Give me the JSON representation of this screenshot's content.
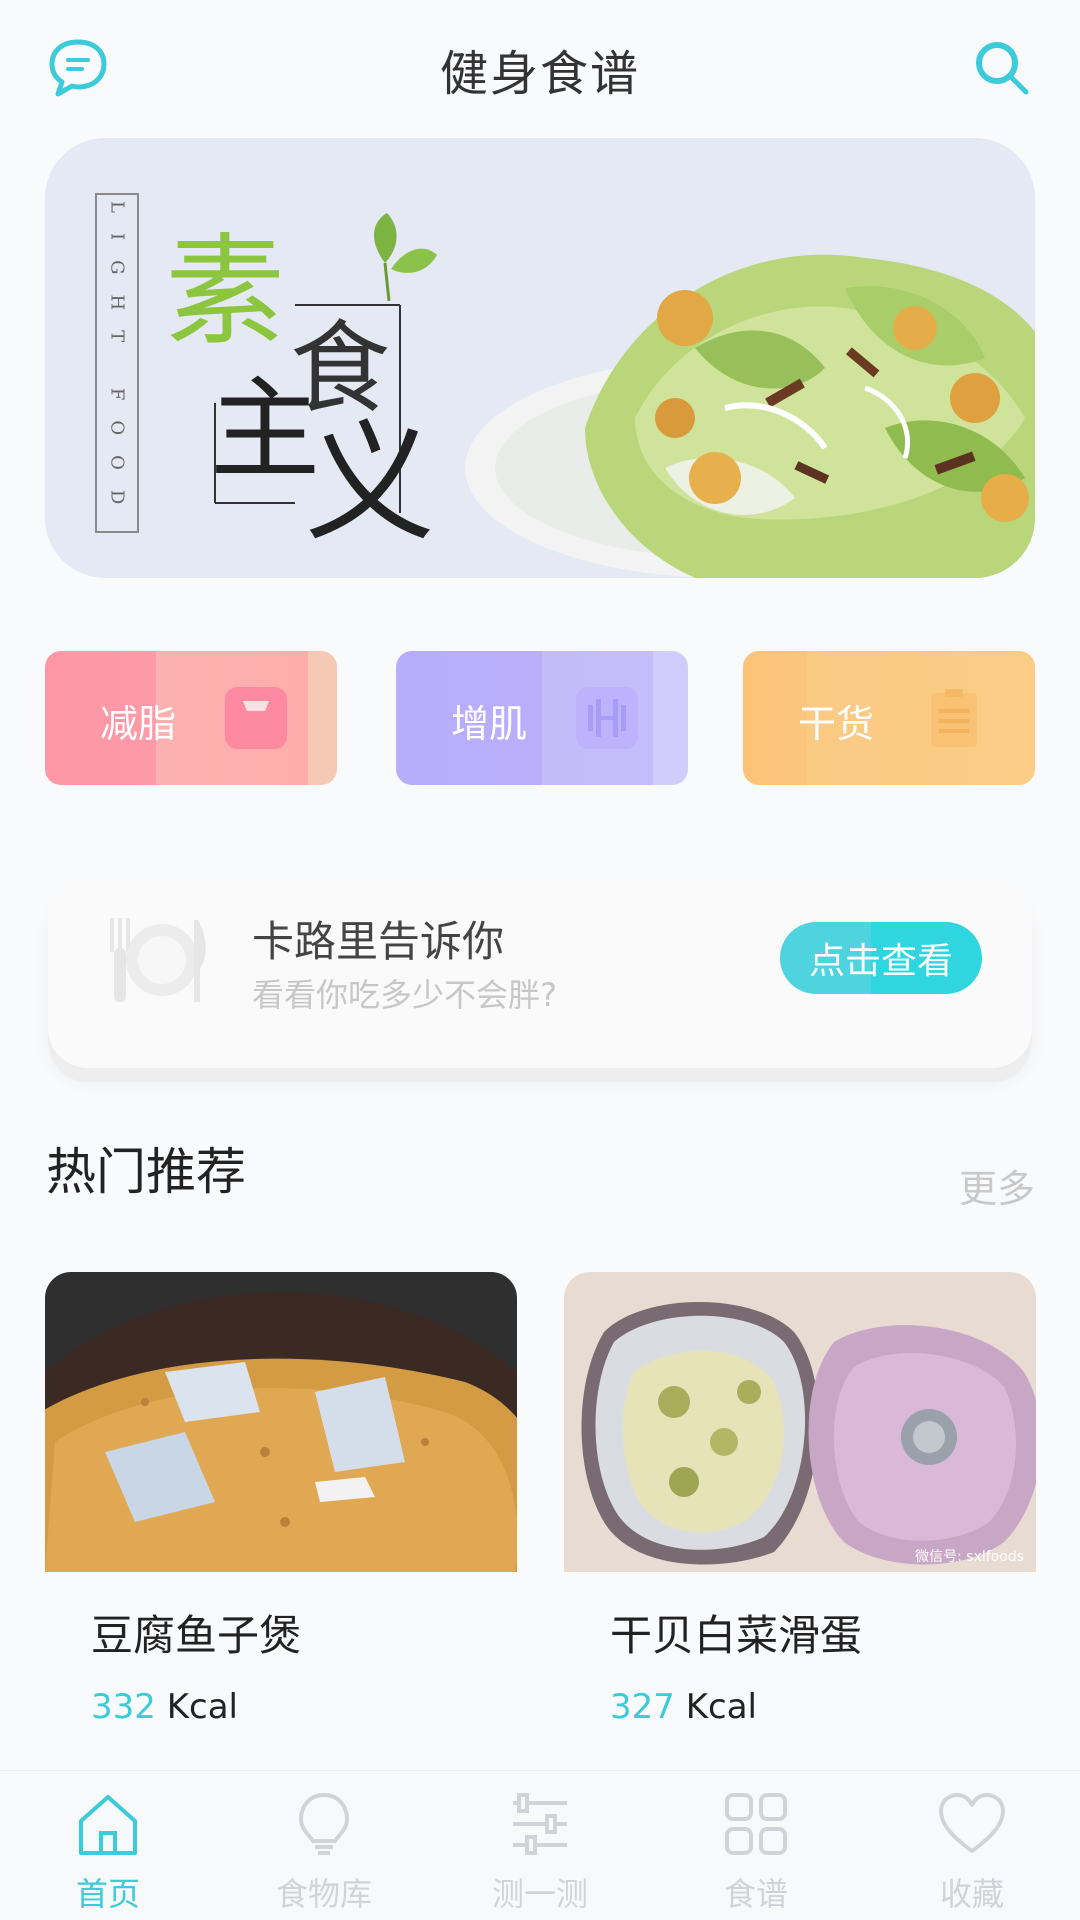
{
  "header": {
    "title": "健身食谱",
    "left_icon": "chat-bubble-icon",
    "right_icon": "search-icon",
    "accent": "#3ccbd8"
  },
  "banner": {
    "vertical_text": "LIGHT FOOD",
    "logo_text": "素食主义"
  },
  "categories": [
    {
      "label": "减脂",
      "icon": "scale-icon",
      "color": "#fd97a6"
    },
    {
      "label": "增肌",
      "icon": "dumbbell-icon",
      "color": "#b8adfb"
    },
    {
      "label": "干货",
      "icon": "clipboard-icon",
      "color": "#fbc57c"
    }
  ],
  "calorie_card": {
    "title": "卡路里告诉你",
    "subtitle": "看看你吃多少不会胖?",
    "button": "点击查看",
    "icon": "plate-utensils-icon"
  },
  "section": {
    "title": "热门推荐",
    "more": "更多"
  },
  "recipes": [
    {
      "name": "豆腐鱼子煲",
      "kcal": "332",
      "unit": "Kcal"
    },
    {
      "name": "干贝白菜滑蛋",
      "kcal": "327",
      "unit": "Kcal"
    }
  ],
  "watermark": "微信号: sxlfoods",
  "tabs": [
    {
      "label": "首页",
      "icon": "home-icon",
      "active": true
    },
    {
      "label": "食物库",
      "icon": "lightbulb-icon",
      "active": false
    },
    {
      "label": "测一测",
      "icon": "sliders-icon",
      "active": false
    },
    {
      "label": "食谱",
      "icon": "grid-icon",
      "active": false
    },
    {
      "label": "收藏",
      "icon": "heart-icon",
      "active": false
    }
  ]
}
